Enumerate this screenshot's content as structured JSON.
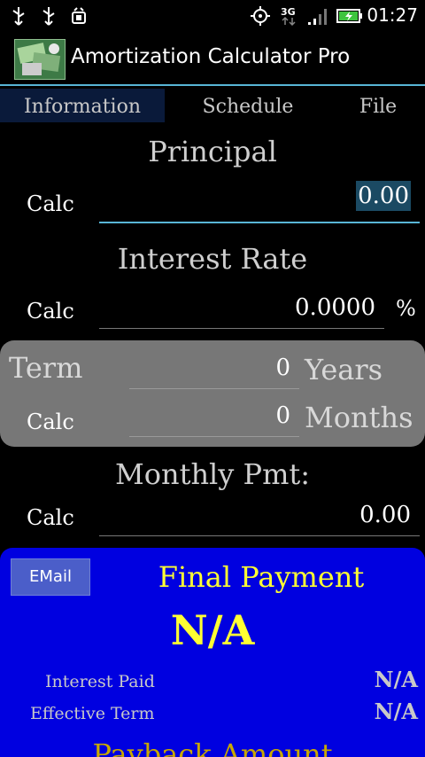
{
  "status_bar": {
    "time": "01:27",
    "icons": [
      "usb-icon",
      "usb-icon",
      "android-debug-icon",
      "gps-icon",
      "3g-signal-icon",
      "signal-bars-icon",
      "battery-charging-icon"
    ]
  },
  "app": {
    "title": "Amortization Calculator Pro"
  },
  "tabs": [
    {
      "label": "Information"
    },
    {
      "label": "Schedule"
    },
    {
      "label": "File"
    }
  ],
  "principal": {
    "heading": "Principal",
    "calc_label": "Calc",
    "value": "0.00"
  },
  "interest": {
    "heading": "Interest Rate",
    "calc_label": "Calc",
    "value": "0.0000",
    "unit": "%"
  },
  "term": {
    "label": "Term",
    "calc_label": "Calc",
    "years_value": "0",
    "years_label": "Years",
    "months_value": "0",
    "months_label": "Months"
  },
  "monthly": {
    "heading": "Monthly Pmt:",
    "calc_label": "Calc",
    "value": "0.00"
  },
  "results": {
    "email_label": "EMail",
    "final_title": "Final Payment",
    "final_value": "N/A",
    "interest_paid_label": "Interest Paid",
    "interest_paid_value": "N/A",
    "effective_term_label": "Effective Term",
    "effective_term_value": "N/A",
    "payback_label": "Payback Amount"
  },
  "colors": {
    "accent": "#58b5d6",
    "panel": "#0000e0",
    "highlight": "#ffff33"
  }
}
